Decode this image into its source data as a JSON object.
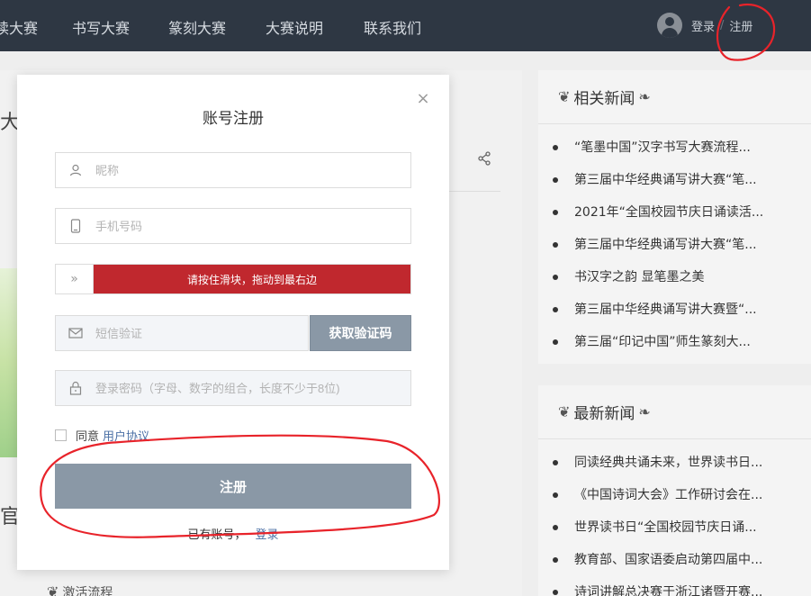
{
  "nav": {
    "items": [
      "读大赛",
      "书写大赛",
      "篆刻大赛",
      "大赛说明",
      "联系我们"
    ],
    "login_label": "登录",
    "separator": "/",
    "register_label": "注册"
  },
  "background": {
    "heading_fragment": "大",
    "heading_fragment_2": "官",
    "bottom_section_title": "激活流程"
  },
  "related_news": {
    "title": "相关新闻",
    "items": [
      "“笔墨中国”汉字书写大赛流程...",
      "第三届中华经典诵写讲大赛“笔...",
      "2021年“全国校园节庆日诵读活...",
      "第三届中华经典诵写讲大赛“笔...",
      "书汉字之韵 显笔墨之美",
      "第三届中华经典诵写讲大赛暨“...",
      "第三届“印记中国”师生篆刻大..."
    ]
  },
  "latest_news": {
    "title": "最新新闻",
    "items": [
      "同读经典共诵未来，世界读书日...",
      "《中国诗词大会》工作研讨会在...",
      "世界读书日“全国校园节庆日诵...",
      "教育部、国家语委启动第四届中...",
      "诗词讲解总决赛于浙江诸暨开赛..."
    ]
  },
  "modal": {
    "title": "账号注册",
    "close_symbol": "×",
    "nickname_placeholder": "昵称",
    "phone_placeholder": "手机号码",
    "slider_handle": "»",
    "slider_text": "请按住滑块，拖动到最右边",
    "sms_placeholder": "短信验证",
    "sms_button": "获取验证码",
    "password_placeholder": "登录密码（字母、数字的组合，长度不少于8位)",
    "agree_text": "同意",
    "agree_link": "用户协议",
    "register_button": "注册",
    "have_account": "已有账号，",
    "login_link": "登录"
  },
  "colors": {
    "nav_bg": "#2e3743",
    "slider_red": "#c0282e",
    "button_gray": "#8a98a6",
    "link_blue": "#4a6fa5",
    "annotation_red": "#e8232a"
  },
  "icons": {
    "nickname": "user-icon",
    "phone": "phone-icon",
    "sms": "mail-icon",
    "password": "lock-icon",
    "share": "share-icon",
    "close": "close-icon"
  }
}
